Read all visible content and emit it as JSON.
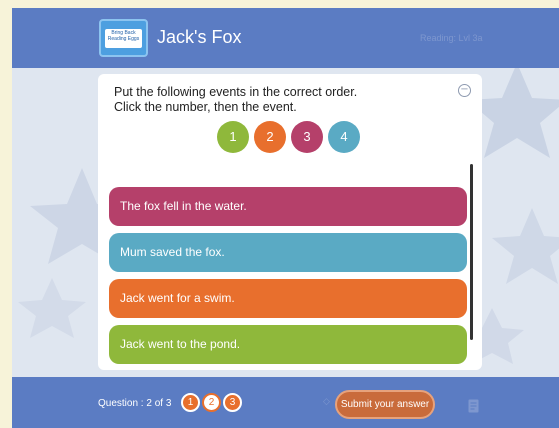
{
  "header": {
    "title": "Jack's Fox",
    "logo_text": "Bring Back Reading Eggs",
    "faint_text": "Reading: Lvl 3a",
    "brand_color": "#5b7cc3"
  },
  "question": {
    "instruction_line1": "Put the following events in the correct order.",
    "instruction_line2": "Click the number, then the event.",
    "collapse_icon": "minus-circle-icon",
    "numbers": [
      {
        "label": "1",
        "color": "#8fb83b"
      },
      {
        "label": "2",
        "color": "#e86f2d"
      },
      {
        "label": "3",
        "color": "#b5406a"
      },
      {
        "label": "4",
        "color": "#5aaac4"
      }
    ],
    "events": [
      {
        "text": "The fox fell in the water.",
        "color": "#b5406a"
      },
      {
        "text": "Mum saved the fox.",
        "color": "#5aaac4"
      },
      {
        "text": "Jack went for a swim.",
        "color": "#e86f2d"
      },
      {
        "text": "Jack went to the pond.",
        "color": "#8fb83b"
      }
    ]
  },
  "footer": {
    "question_label": "Question : 2 of 3",
    "question_dots": [
      {
        "label": "1",
        "state": "done"
      },
      {
        "label": "2",
        "state": "current"
      },
      {
        "label": "3",
        "state": "done"
      }
    ],
    "submit_label": "Submit your answer",
    "notes_icon": "notes-icon"
  }
}
